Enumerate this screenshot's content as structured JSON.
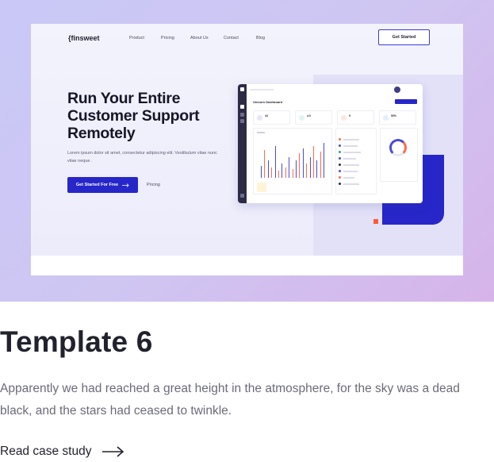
{
  "hero": {
    "nav": {
      "logo": "{finsweet",
      "links": [
        "Product",
        "Pricing",
        "About Us",
        "Contact",
        "Blog"
      ],
      "cta_label": "Get Started"
    },
    "headline": "Run Your Entire Customer Support Remotely",
    "subtext": "Lorem ipsum dolor sit amet, consectetur adipiscing elit. Vestibulum vitae nunc vitae neque .",
    "primary_cta": "Get Started For Free",
    "secondary_link": "Pricing",
    "dashboard": {
      "title": "Unicorn Dashboard"
    }
  },
  "card": {
    "title": "Template 6",
    "description": "Apparently we had reached a great height in the atmosphere, for the sky was a dead black, and the stars had ceased to twinkle.",
    "link_label": "Read case study"
  },
  "colors": {
    "accent": "#2626c9",
    "orange": "#ff5a36",
    "sidebar": "#2b2b45"
  }
}
